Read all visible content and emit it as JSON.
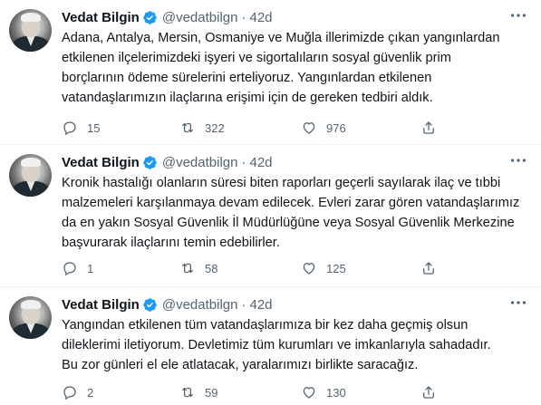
{
  "colors": {
    "verified": "#1d9bf0",
    "muted": "#536471",
    "text": "#0f1419"
  },
  "icons": {
    "verified": "verified-badge-icon",
    "more": "more-dots-icon",
    "reply": "reply-icon",
    "retweet": "retweet-icon",
    "like": "heart-icon",
    "share": "share-icon"
  },
  "tweets": [
    {
      "name": "Vedat Bilgin",
      "handle": "@vedatbilgn",
      "separator": "·",
      "time": "42d",
      "text": "Adana, Antalya, Mersin, Osmaniye ve Muğla illerimizde çıkan yangınlardan\netkilenen ilçelerimizdeki işyeri ve sigortalıların sosyal güvenlik prim\nborçlarının ödeme sürelerini erteliyoruz. Yangınlardan etkilenen\nvatandaşlarımızın ilaçlarına erişimi için de gereken tedbiri aldık.",
      "replies": "15",
      "retweets": "322",
      "likes": "976"
    },
    {
      "name": "Vedat Bilgin",
      "handle": "@vedatbilgn",
      "separator": "·",
      "time": "42d",
      "text": "Kronik hastalığı olanların süresi biten raporları geçerli sayılarak ilaç ve tıbbi\nmalzemeleri karşılanmaya devam edilecek. Evleri zarar gören vatandaşlarımız\nda en yakın Sosyal Güvenlik İl Müdürlüğüne veya Sosyal Güvenlik Merkezine\nbaşvurarak ilaçlarını temin edebilirler.",
      "replies": "1",
      "retweets": "58",
      "likes": "125"
    },
    {
      "name": "Vedat Bilgin",
      "handle": "@vedatbilgn",
      "separator": "·",
      "time": "42d",
      "text": "Yangından etkilenen tüm vatandaşlarımıza bir kez daha geçmiş olsun\ndileklerimi iletiyorum. Devletimiz tüm kurumları ve imkanlarıyla sahadadır.\nBu zor günleri el ele atlatacak, yaralarımızı birlikte saracağız.",
      "replies": "2",
      "retweets": "59",
      "likes": "130"
    }
  ]
}
